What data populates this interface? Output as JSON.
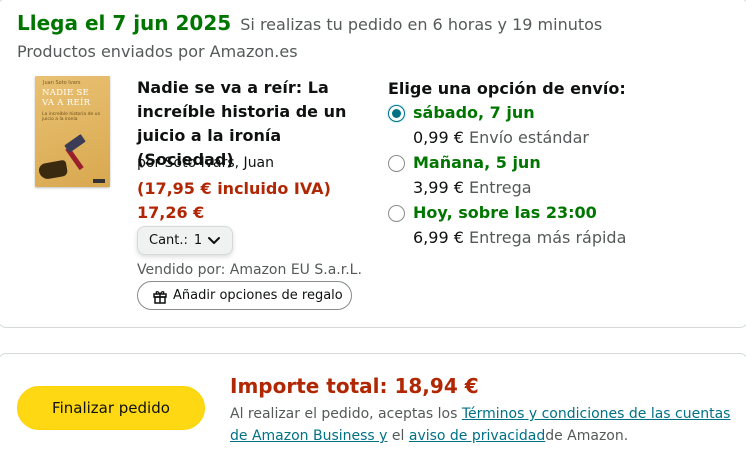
{
  "delivery": {
    "headline": "Llega el 7 jun 2025",
    "condition": "Si realizas tu pedido en 6 horas y 19 minutos",
    "shipped_by": "Productos enviados por Amazon.es"
  },
  "item": {
    "cover": {
      "author_line": "Juan Soto Ivars",
      "title_line1": "NADIE SE",
      "title_line2": "VA A REÍR",
      "subtitle": "La increíble historia de un juicio a la ironía",
      "colors": {
        "background": "#e0b460"
      }
    },
    "title": "Nadie se va a reír: La increíble historia de un juicio a la ironía (Sociedad)",
    "author": "por Soto Ivars, Juan",
    "price": "(17,95 € incluido IVA) 17,26 €",
    "quantity_label": "Cant.:",
    "quantity_value": "1",
    "seller": "Vendido por: Amazon EU S.a.r.L.",
    "gift_button": "Añadir opciones de regalo"
  },
  "shipping": {
    "heading": "Elige una opción de envío:",
    "options": [
      {
        "label": "sábado, 7 jun",
        "price": "0,99 €",
        "desc": "Envío estándar",
        "selected": true
      },
      {
        "label": "Mañana, 5 jun",
        "price": "3,99 €",
        "desc": "Entrega",
        "selected": false
      },
      {
        "label": "Hoy, sobre las 23:00",
        "price": "6,99 €",
        "desc": "Entrega más rápida",
        "selected": false
      }
    ]
  },
  "checkout": {
    "button": "Finalizar pedido",
    "total_label": "Importe total:",
    "total_value": "18,94 €",
    "legal_prefix": "Al realizar el pedido, aceptas los ",
    "legal_link1": "Términos y condiciones de las cuentas de Amazon Business y",
    "legal_middle": " el ",
    "legal_link2": "aviso de privacidad",
    "legal_suffix": "de Amazon."
  },
  "icons": {
    "gift": "gift-icon",
    "chevron": "chevron-down-icon"
  },
  "colors": {
    "green": "#007600",
    "price_red": "#b12704",
    "link": "#007185",
    "button_yellow": "#ffd814"
  }
}
